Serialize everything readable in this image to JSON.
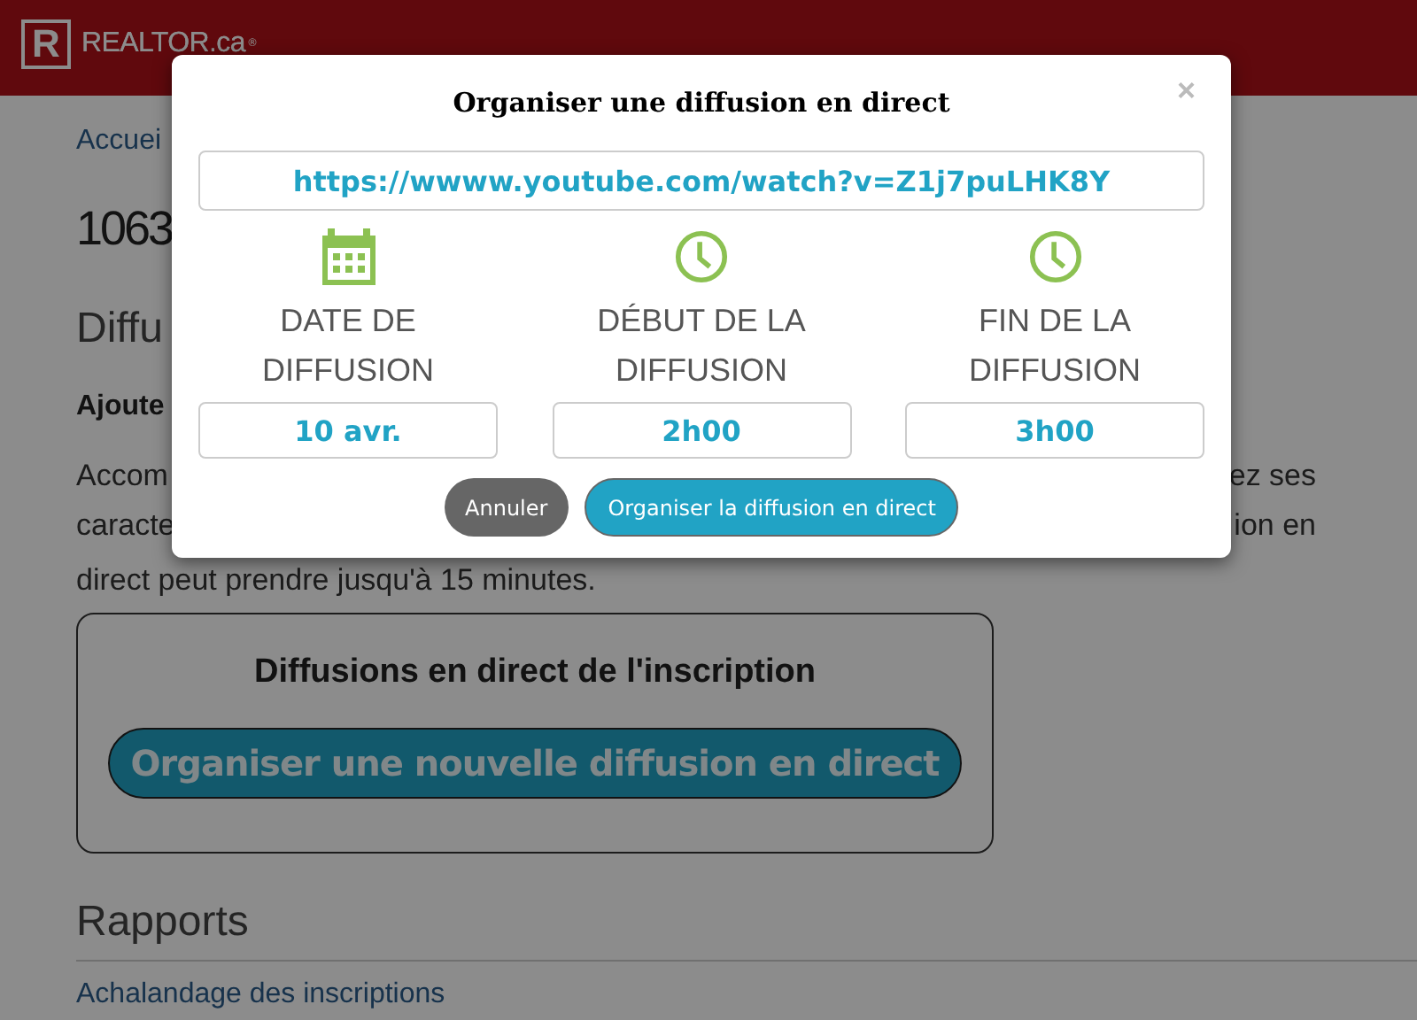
{
  "header": {
    "logo_letter": "R",
    "logo_text": "REALTOR.ca",
    "logo_mark": "®"
  },
  "page": {
    "breadcrumb": "Accuei",
    "title": "1063",
    "section": "Diffu",
    "subheading": "Ajoute",
    "paragraph_lines": [
      {
        "left": "Accom",
        "right": "ez ses"
      },
      {
        "left": "caracte",
        "right": "ion en"
      },
      {
        "left": "direct peut prendre jusqu'à 15 minutes."
      }
    ],
    "card": {
      "title": "Diffusions en direct de l'inscription",
      "button": "Organiser une nouvelle diffusion en direct"
    },
    "reports": {
      "heading": "Rapports",
      "link": "Achalandage des inscriptions"
    }
  },
  "modal": {
    "title": "Organiser une diffusion en direct",
    "close": "×",
    "url": "https://wwww.youtube.com/watch?v=Z1j7puLHK8Y",
    "fields": [
      {
        "kind": "date",
        "label_lines": [
          "DATE DE",
          "DIFFUSION"
        ],
        "value": "10 avr."
      },
      {
        "kind": "time",
        "label_lines": [
          "DÉBUT DE LA",
          "DIFFUSION"
        ],
        "value": "2h00"
      },
      {
        "kind": "time",
        "label_lines": [
          "FIN DE LA",
          "DIFFUSION"
        ],
        "value": "3h00"
      }
    ],
    "buttons": [
      {
        "kind": "cancel",
        "label": "Annuler"
      },
      {
        "kind": "primary",
        "label": "Organiser la diffusion en direct"
      }
    ]
  }
}
